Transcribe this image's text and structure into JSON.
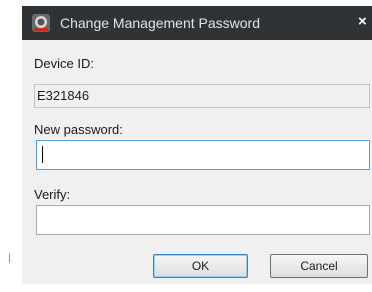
{
  "dialog": {
    "title": "Change Management Password",
    "close_glyph": "×",
    "app_icon": "app-logo-icon"
  },
  "form": {
    "device_id_label": "Device ID:",
    "device_id_value": "E321846",
    "new_password_label": "New password:",
    "new_password_value": "",
    "verify_label": "Verify:",
    "verify_value": ""
  },
  "buttons": {
    "ok_label": "OK",
    "cancel_label": "Cancel"
  },
  "colors": {
    "titlebar": "#303336",
    "dialog_body": "#f0f0f0",
    "focused_input_border": "#5a9fd8"
  }
}
